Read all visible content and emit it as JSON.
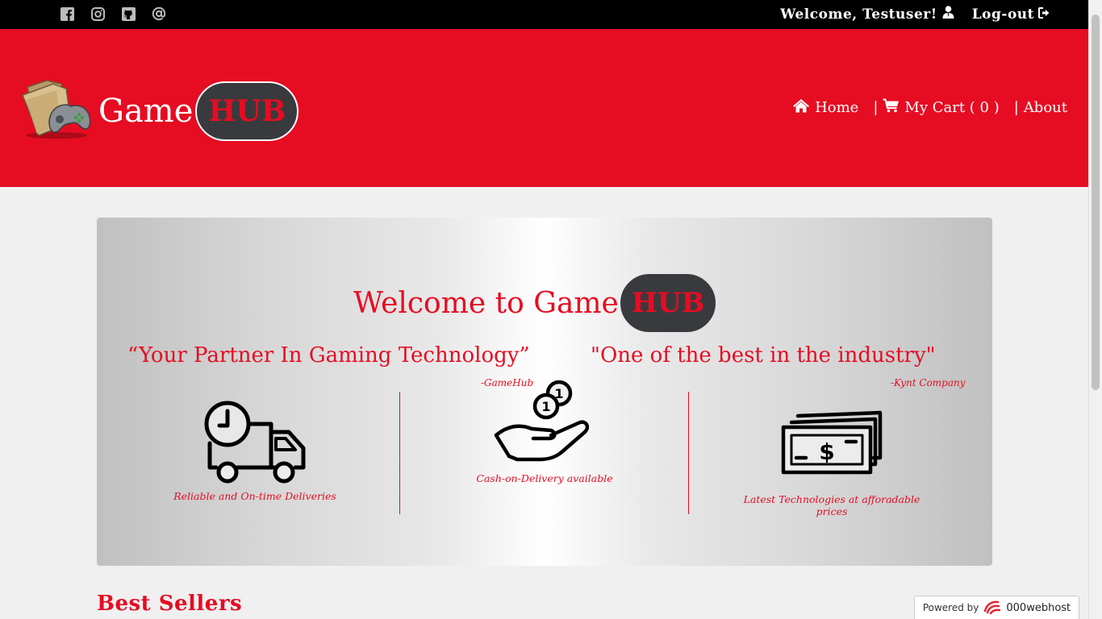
{
  "topbar": {
    "social": [
      "facebook-icon",
      "instagram-icon",
      "github-icon",
      "email-at-icon"
    ],
    "welcome_text": "Welcome, Testuser!",
    "logout_label": "Log-out"
  },
  "header": {
    "brand_game": "Game",
    "brand_hub": "HUB",
    "nav": {
      "home": "Home",
      "cart_label": "My Cart ( 0 )",
      "about": "About",
      "separator": "|"
    }
  },
  "hero": {
    "welcome_text": "Welcome to Game",
    "welcome_hub": "HUB",
    "quote1": "“Your Partner In Gaming Technology”",
    "cite1": "-GameHub",
    "quote2": "\"One of the best in the industry\"",
    "cite2": "-Kynt Company",
    "features": [
      {
        "icon": "delivery-truck-clock-icon",
        "caption": "Reliable and On-time Deliveries"
      },
      {
        "icon": "hand-coins-icon",
        "caption": "Cash-on-Delivery available"
      },
      {
        "icon": "money-stack-icon",
        "caption": "Latest Technologies at afforadable prices"
      }
    ]
  },
  "section": {
    "best_sellers": "Best Sellers"
  },
  "footer_badge": {
    "powered_by": "Powered by",
    "host": "000webhost"
  },
  "colors": {
    "brand_red": "#e60c22",
    "pill_dark": "#393a3d",
    "topbar": "#000000"
  }
}
